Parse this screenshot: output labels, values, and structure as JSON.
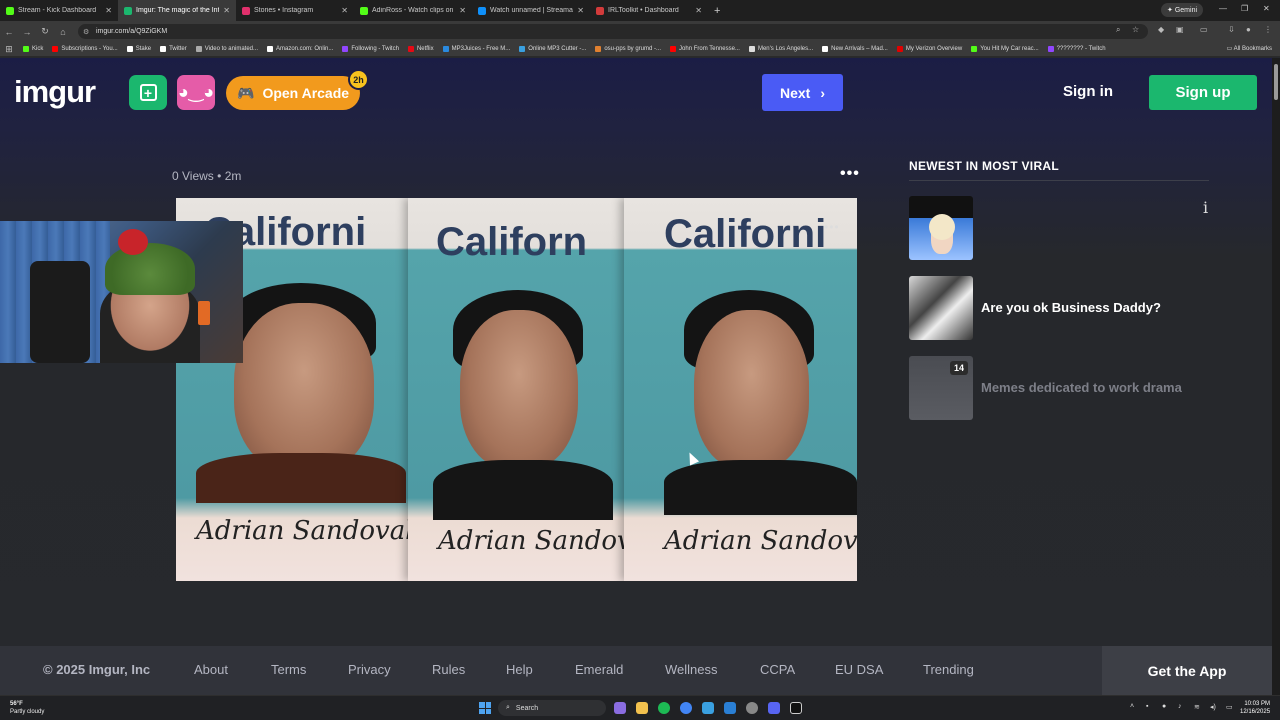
{
  "browser": {
    "tabs": [
      {
        "title": "Stream - Kick Dashboard",
        "color": "#53fc18",
        "active": false
      },
      {
        "title": "Imgur: The magic of the Intern",
        "color": "#1bb76e",
        "active": true
      },
      {
        "title": "Stories • Instagram",
        "color": "#e1306c",
        "active": false
      },
      {
        "title": "AdinRoss - Watch clips on Kick",
        "color": "#53fc18",
        "active": false
      },
      {
        "title": "Watch unnamed | Streamable",
        "color": "#0f90fa",
        "active": false
      },
      {
        "title": "IRLToolkit • Dashboard",
        "color": "#d33b3b",
        "active": false
      }
    ],
    "gemini_label": "Gemini",
    "url": "imgur.com/a/Q9ZiGKM",
    "bookmarks": [
      {
        "label": "Kick",
        "color": "#53fc18"
      },
      {
        "label": "Subscriptions - You...",
        "color": "#ff0000"
      },
      {
        "label": "Stake",
        "color": "#ffffff"
      },
      {
        "label": "Twitter",
        "color": "#ffffff"
      },
      {
        "label": "Video to animated...",
        "color": "#aaaaaa"
      },
      {
        "label": "Amazon.com: Onlin...",
        "color": "#ffffff"
      },
      {
        "label": "Following - Twitch",
        "color": "#9146ff"
      },
      {
        "label": "Netflix",
        "color": "#e50914"
      },
      {
        "label": "MP3Juices - Free M...",
        "color": "#2a8adf"
      },
      {
        "label": "Online MP3 Cutter -...",
        "color": "#3aa0e0"
      },
      {
        "label": "osu-pps by grumd -...",
        "color": "#e08030"
      },
      {
        "label": "John From Tennesse...",
        "color": "#ff0000"
      },
      {
        "label": "Men's Los Angeles...",
        "color": "#dddddd"
      },
      {
        "label": "New Arrivals – Mad...",
        "color": "#ffffff"
      },
      {
        "label": "My Verizon Overview",
        "color": "#e00000"
      },
      {
        "label": "You Hit My Car reac...",
        "color": "#53fc18"
      },
      {
        "label": "???????? - Twitch",
        "color": "#9146ff"
      }
    ],
    "all_bookmarks_label": "All Bookmarks"
  },
  "header": {
    "logo": "imgur",
    "arcade_label": "Open Arcade",
    "arcade_badge": "2h",
    "next_label": "Next",
    "signin_label": "Sign in",
    "signup_label": "Sign up"
  },
  "post": {
    "views": "0 Views",
    "age": "2m",
    "image_state_text": "Californi",
    "image_state_text_2": "Californ",
    "signature": "Adrian Sandoval"
  },
  "sidebar": {
    "heading": "NEWEST IN MOST VIRAL",
    "items": [
      {
        "title": "",
        "badge": ""
      },
      {
        "title": "Are you ok Business Daddy?",
        "badge": ""
      },
      {
        "title": "Memes dedicated to work drama",
        "badge": "14"
      }
    ]
  },
  "footer": {
    "copyright": "© 2025 Imgur, Inc",
    "links": [
      "About",
      "Terms",
      "Privacy",
      "Rules",
      "Help",
      "Emerald",
      "Wellness",
      "CCPA",
      "EU DSA",
      "Trending"
    ],
    "get_app": "Get the App"
  },
  "taskbar": {
    "temp": "56°F",
    "weather": "Partly cloudy",
    "search_placeholder": "Search",
    "time": "10:03 PM",
    "date": "12/16/2025"
  }
}
